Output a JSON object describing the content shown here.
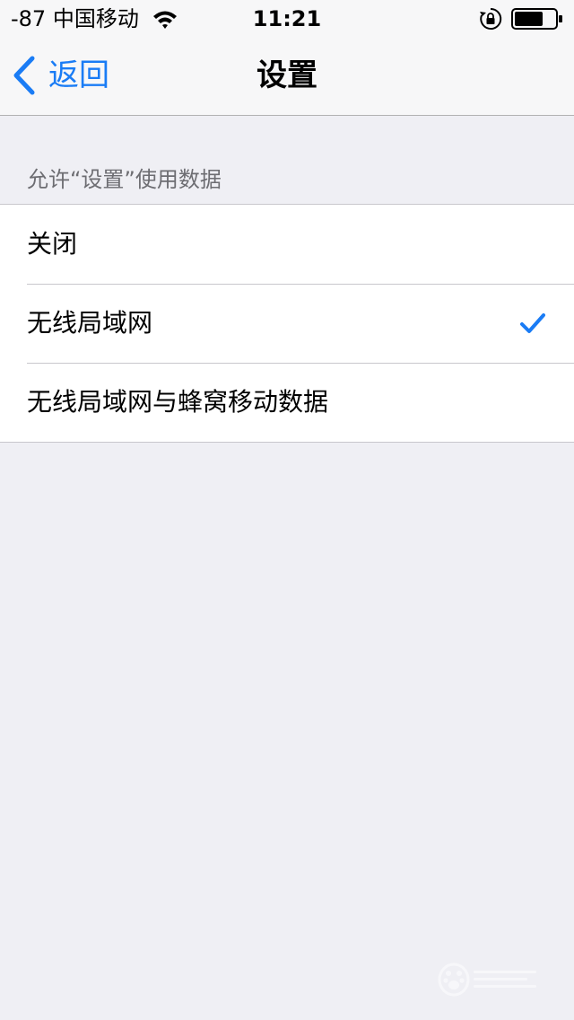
{
  "status_bar": {
    "carrier": "-87 中国移动",
    "time": "11:21",
    "battery_level": 0.7
  },
  "nav": {
    "back_label": "返回",
    "title": "设置"
  },
  "section": {
    "header": "允许“设置”使用数据",
    "options": [
      {
        "label": "关闭",
        "selected": false
      },
      {
        "label": "无线局域网",
        "selected": true
      },
      {
        "label": "无线局域网与蜂窝移动数据",
        "selected": false
      }
    ]
  },
  "colors": {
    "accent": "#1a7cf5",
    "background": "#efeff4",
    "separator": "#c8c7cc",
    "header_text": "#6d6d72"
  },
  "icons": {
    "wifi": "wifi-icon",
    "rotation_lock": "rotation-lock-icon",
    "battery": "battery-icon",
    "back": "chevron-left-icon",
    "checkmark": "checkmark-icon",
    "watermark": "baidu-jingyan-watermark"
  }
}
